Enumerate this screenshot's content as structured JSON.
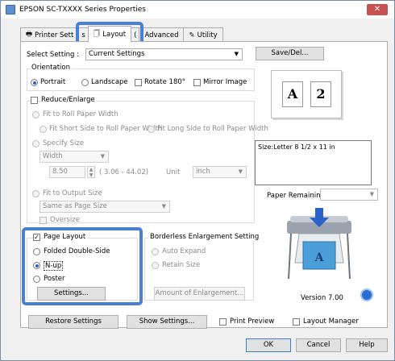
{
  "window": {
    "title": "EPSON SC-TXXXX Series Properties",
    "close_label": "✕"
  },
  "tabs": [
    {
      "label": "Printer Sett"
    },
    {
      "label": "Layout"
    },
    {
      "label": "Advanced"
    },
    {
      "label": "Utility"
    }
  ],
  "select_setting": {
    "label": "Select Setting :",
    "value": "Current Settings",
    "save_label": "Save/Del..."
  },
  "orientation": {
    "group_label": "Orientation",
    "portrait": "Portrait",
    "landscape": "Landscape",
    "rotate": "Rotate 180°",
    "mirror": "Mirror Image"
  },
  "preview": {
    "left": "A",
    "right": "2"
  },
  "reduce": {
    "label": "Reduce/Enlarge",
    "fit_roll": "Fit to Roll Paper Width",
    "fit_short": "Fit Short Side to Roll Paper Width",
    "fit_long": "Fit Long Side to Roll Paper Width",
    "specify": "Specify Size",
    "width_select": "Width",
    "width_value": "8.50",
    "range": "( 3.06 - 44.02)",
    "unit_label": "Unit",
    "unit_value": "inch",
    "fit_output": "Fit to Output Size",
    "output_value": "Same as Page Size",
    "oversize": "Oversize"
  },
  "size_info": "Size:Letter 8 1/2 x 11 in",
  "paper_remaining": {
    "label": "Paper Remaining:"
  },
  "page_layout": {
    "label": "Page Layout",
    "folded": "Folded Double-Side",
    "nup": "N-up",
    "poster": "Poster",
    "settings": "Settings..."
  },
  "borderless": {
    "group_label": "Borderless Enlargement Setting",
    "auto": "Auto Expand",
    "retain": "Retain Size",
    "amount": "Amount of Enlargement..."
  },
  "version": "Version 7.00",
  "bottom": {
    "restore": "Restore Settings",
    "show": "Show Settings...",
    "print_preview": "Print Preview",
    "layout_manager": "Layout Manager"
  },
  "footer": {
    "ok": "OK",
    "cancel": "Cancel",
    "help": "Help"
  },
  "colors": {
    "highlight": "#4a7fd8",
    "accent": "#2a62c9"
  }
}
